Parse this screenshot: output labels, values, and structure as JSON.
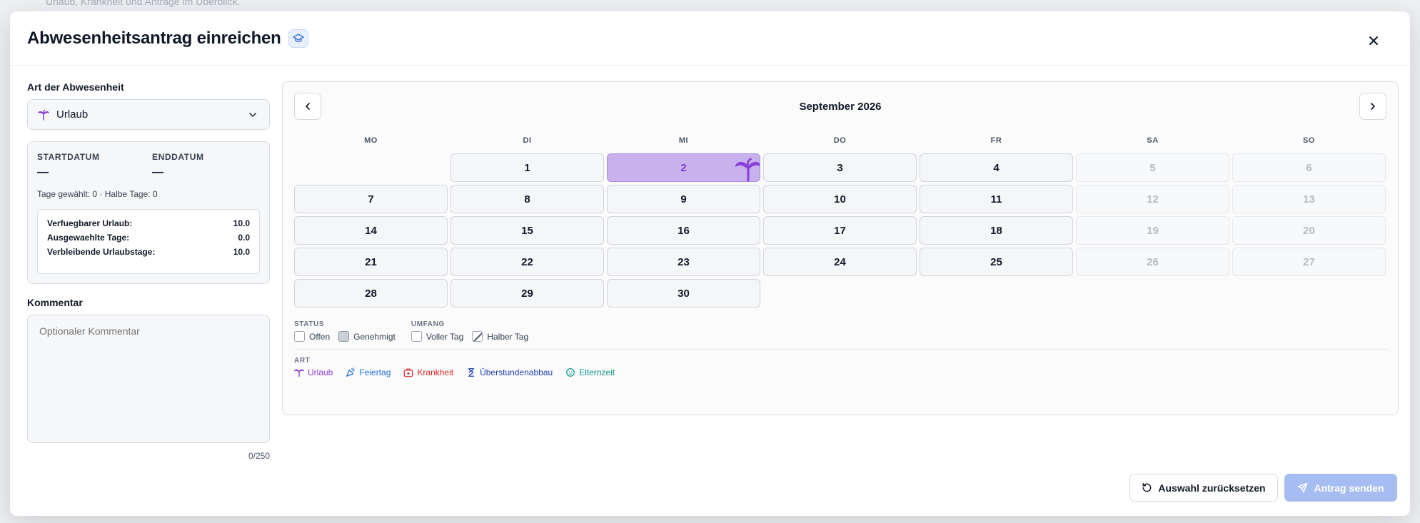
{
  "background": {
    "subtitle": "Urlaub, Krankheit und Anträge im Überblick."
  },
  "modal": {
    "title": "Abwesenheitsantrag einreichen",
    "close_label": "×"
  },
  "absence_type": {
    "label": "Art der Abwesenheit",
    "selected": "Urlaub"
  },
  "dates": {
    "start_label": "STARTDATUM",
    "start_value": "—",
    "end_label": "ENDDATUM",
    "end_value": "—",
    "days_info": "Tage gewählt: 0 · Halbe Tage: 0"
  },
  "balance": {
    "rows": [
      {
        "label": "Verfuegbarer Urlaub:",
        "value": "10.0"
      },
      {
        "label": "Ausgewaehlte Tage:",
        "value": "0.0"
      },
      {
        "label": "Verbleibende Urlaubstage:",
        "value": "10.0"
      }
    ]
  },
  "comment": {
    "label": "Kommentar",
    "placeholder": "Optionaler Kommentar",
    "value": "",
    "count": "0/250"
  },
  "calendar": {
    "month": "September 2026",
    "weekdays": [
      "MO",
      "DI",
      "MI",
      "DO",
      "FR",
      "SA",
      "SO"
    ],
    "days": [
      [
        null,
        "1",
        "2",
        "3",
        "4",
        "5",
        "6"
      ],
      [
        "7",
        "8",
        "9",
        "10",
        "11",
        "12",
        "13"
      ],
      [
        "14",
        "15",
        "16",
        "17",
        "18",
        "19",
        "20"
      ],
      [
        "21",
        "22",
        "23",
        "24",
        "25",
        "26",
        "27"
      ],
      [
        "28",
        "29",
        "30",
        null,
        null,
        null,
        null
      ]
    ],
    "selected_day": "2",
    "weekend_columns": [
      5,
      6
    ]
  },
  "legend": {
    "status_label": "STATUS",
    "status_items": [
      "Offen",
      "Genehmigt"
    ],
    "scope_label": "UMFANG",
    "scope_items": [
      "Voller Tag",
      "Halber Tag"
    ],
    "type_label": "ART",
    "types": [
      {
        "label": "Urlaub",
        "color": "#8b3fd9",
        "icon": "palm-tree-icon"
      },
      {
        "label": "Feiertag",
        "color": "#1d6fd6",
        "icon": "party-popper-icon"
      },
      {
        "label": "Krankheit",
        "color": "#dc2626",
        "icon": "medical-bag-icon"
      },
      {
        "label": "Überstundenabbau",
        "color": "#1e40af",
        "icon": "hourglass-icon"
      },
      {
        "label": "Elternzeit",
        "color": "#0d9488",
        "icon": "baby-icon"
      }
    ]
  },
  "actions": {
    "reset_label": "Auswahl zurücksetzen",
    "send_label": "Antrag senden"
  },
  "colors": {
    "selected_day_bg": "#c8b1ec",
    "send_button_bg": "#a6bdf3"
  }
}
